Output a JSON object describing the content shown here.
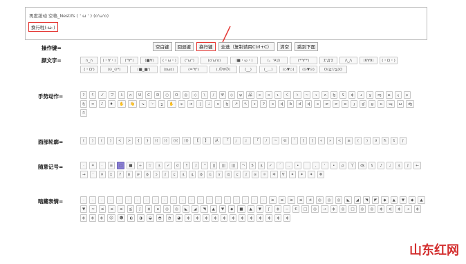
{
  "input": {
    "line1": "再度拨动 空格_Nestifs ( ' ω ' ) (o'ω'o)",
    "line2": "换行啦(-ω-)"
  },
  "labels": {
    "ops": "操作键=",
    "yanwenzi": "颜文字=",
    "shoushi": "手势动作=",
    "mianbu": "面部轮廓=",
    "suiyi": "随意记号=",
    "jianyi": "暗藏表情="
  },
  "ops": [
    "空白键",
    "回退键",
    "换行键",
    "全选（复制请用Ctrl+C）",
    "清空",
    "跳到下面"
  ],
  "yanwenzi": [
    [
      "∩_∩",
      "(・∀・)",
      "(\"∀\")",
      "(■∀)",
      "(・ω・)",
      "(\"ω\")",
      "(o'ω'o)",
      "(■・ω・)",
      "(。'A'ʃ)",
      "(*'∀'*)"
    ],
    [
      "Σ'Д'Σ",
      "/\\_/\\",
      "(6∀9)",
      "(・Ω・)",
      "(・Ω')",
      "(⊙_⊙*)",
      "(■_■')",
      "(ಠωಠ)",
      "(='∀')"
    ],
    [
      "(,の∀の)",
      "(__)",
      "(_＿)",
      "(◇▼◇)",
      "(⊙▼⊙)",
      "O(≧▽≦)O"
    ]
  ],
  "shoushi": [
    [
      "ʔ",
      "ʕ",
      "ノ",
      "フ",
      "ʖ",
      "∩",
      "U",
      "C",
      "D",
      "○",
      "O",
      "◎",
      "◇",
      "\\",
      "/",
      "Ψ",
      "◇",
      "ψ",
      "品"
    ],
    [
      "c",
      "ɔ",
      "ɿ",
      "く",
      "ゝ",
      "~",
      "ɩ",
      "ʌ",
      "ɮ",
      "ʢ",
      "ɸ",
      "ɹ",
      "ɣ",
      "ɱ",
      "ɷ",
      "ɻ",
      "ɕ",
      "ɧ",
      "∞"
    ],
    [
      "♪",
      "♦",
      "✋",
      "👋",
      "↘",
      "☞",
      "ʓ",
      "✋",
      "ɕ",
      "➜",
      "ɭ",
      "♩",
      "ɤ",
      "ɮ",
      "↗",
      "↖",
      "ɪ",
      "ʔ",
      "ɜ"
    ],
    [
      "ɖ",
      "ɓ",
      "ɗ",
      "ɖ",
      "ɜ",
      "ɚ",
      "ɝ",
      "ɞ",
      "ɟ",
      "ɠ",
      "ɡ",
      "ɢ",
      "ɰ",
      "ω",
      "ʤ",
      "ʭ"
    ]
  ],
  "mianbu": [
    [
      "(",
      ")",
      "(",
      ")",
      "<",
      ">",
      "{",
      "}",
      "((",
      "))",
      "(((",
      ")))",
      "【",
      "】",
      "从",
      "「",
      "」",
      "』",
      "『"
    ],
    [
      "/",
      "~",
      "∈",
      "ˆ",
      "[",
      "]",
      "«",
      "»",
      "<",
      "≥",
      "(",
      ")",
      "∂",
      "ħ",
      "ʢ",
      "ʃ"
    ]
  ],
  "suiyi": [
    [
      "·",
      "✶",
      "·",
      "≡",
      "□",
      "■",
      "÷",
      "☆",
      "ʒ",
      "✓",
      "σ",
      "↑",
      "ʃ",
      "''",
      "||",
      "|||",
      "|||",
      "¬",
      "5",
      "ʒ",
      "✓",
      "´"
    ],
    [
      "..",
      "•",
      "",
      ",",
      "'",
      "•",
      "ρ",
      "丫",
      "ʤ",
      "ʢ",
      "♪",
      "♩",
      "ʒ",
      "ʃ",
      "←",
      "→",
      "ʼ",
      "ǂ",
      "‡",
      "ʔ",
      "ɸ"
    ],
    [
      "ɚ",
      "ɸ",
      "ɔ",
      "ʃ",
      "ɕ",
      "ʒ",
      "ʓ",
      "ɸ",
      "ɢ",
      "ɤ",
      "ɖ",
      "ɕ",
      "ʃ",
      "ɞ",
      "☼",
      "✲",
      "∀",
      "✦",
      "✦",
      "✦",
      "❖"
    ]
  ],
  "jianyi": [
    [
      "·",
      "·",
      "·",
      "·",
      "·",
      "·",
      "·",
      "·",
      "·",
      "·",
      "·",
      "·",
      "·",
      "·",
      "·",
      "·",
      "·",
      "·",
      "·",
      "·",
      "·"
    ],
    [
      "≥",
      "≤",
      "≥",
      "≤",
      "≮",
      "◎",
      "◎",
      "◎",
      "◣",
      "◢",
      "◥",
      "◤",
      "◆",
      "▲",
      "▼",
      "◆",
      "▲",
      "▼"
    ],
    [
      "≈",
      "≤",
      "≤",
      "≤",
      "≦",
      "ʃ",
      "ɸ",
      "ɵ",
      "◎",
      "◎",
      "◣",
      "◢",
      "◥",
      "▲",
      "▼",
      "◆",
      "■",
      "▲",
      "▼"
    ],
    [
      "ʃ",
      "ɸ",
      "─",
      "€",
      "□",
      "◎",
      "→",
      "ɸ",
      "◎",
      "□",
      "◎",
      "◎",
      "ɸ",
      "ɖ",
      "ɸ",
      "÷",
      "ɸ",
      "ɸ",
      "ɸ",
      "ɸ"
    ],
    [
      "☺",
      "☻",
      "◐",
      "◑",
      "◒",
      "◓",
      "◔",
      "◕",
      "ɸ",
      "ɸ",
      "ɸ",
      "ɸ",
      "ɸ",
      "ɸ",
      "ɸ",
      "ɸ",
      "ɸ",
      "ɸ",
      "ɸ",
      "ɸ"
    ]
  ],
  "watermark": "山东红网"
}
